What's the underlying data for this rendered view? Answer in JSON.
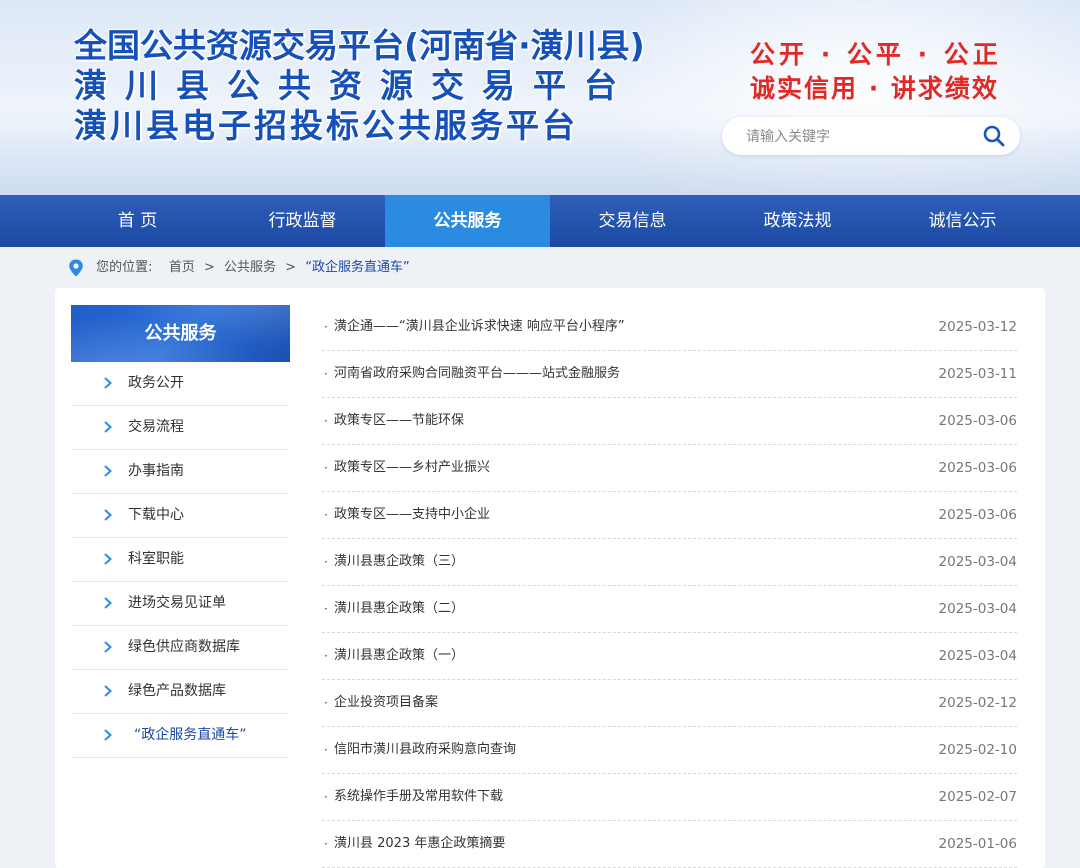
{
  "header": {
    "title_lines": [
      "全国公共资源交易平台(河南省·潢川县)",
      "潢川县公共资源交易平台",
      "潢川县电子招投标公共服务平台"
    ],
    "slogan_line1": "公开 · 公平 · 公正",
    "slogan_line2": "诚实信用 · 讲求绩效",
    "search_placeholder": "请输入关键字",
    "search_icon": "search-icon"
  },
  "nav": {
    "items": [
      "首  页",
      "行政监督",
      "公共服务",
      "交易信息",
      "政策法规",
      "诚信公示"
    ],
    "active_index": 2
  },
  "breadcrumb": {
    "prefix": "您的位置:",
    "home": "首页",
    "section": "公共服务",
    "current": "“政企服务直通车”",
    "separator": ">"
  },
  "sidebar": {
    "heading": "公共服务",
    "items": [
      "政务公开",
      "交易流程",
      "办事指南",
      "下载中心",
      "科室职能",
      "进场交易见证单",
      "绿色供应商数据库",
      "绿色产品数据库",
      "“政企服务直通车”"
    ],
    "active_index": 8
  },
  "articles": [
    {
      "title": "潢企通——“潢川县企业诉求快速 响应平台小程序”",
      "date": "2025-03-12"
    },
    {
      "title": "河南省政府采购合同融资平台———站式金融服务",
      "date": "2025-03-11"
    },
    {
      "title": "政策专区——节能环保",
      "date": "2025-03-06"
    },
    {
      "title": "政策专区——乡村产业振兴",
      "date": "2025-03-06"
    },
    {
      "title": "政策专区——支持中小企业",
      "date": "2025-03-06"
    },
    {
      "title": "潢川县惠企政策（三）",
      "date": "2025-03-04"
    },
    {
      "title": "潢川县惠企政策（二）",
      "date": "2025-03-04"
    },
    {
      "title": "潢川县惠企政策（一）",
      "date": "2025-03-04"
    },
    {
      "title": "企业投资项目备案",
      "date": "2025-02-12"
    },
    {
      "title": "信阳市潢川县政府采购意向查询",
      "date": "2025-02-10"
    },
    {
      "title": "系统操作手册及常用软件下载",
      "date": "2025-02-07"
    },
    {
      "title": "潢川县 2023 年惠企政策摘要",
      "date": "2025-01-06"
    }
  ],
  "colors": {
    "brand_blue": "#1b49a3",
    "nav_active": "#2b8be0",
    "slogan_red": "#e02a26"
  }
}
